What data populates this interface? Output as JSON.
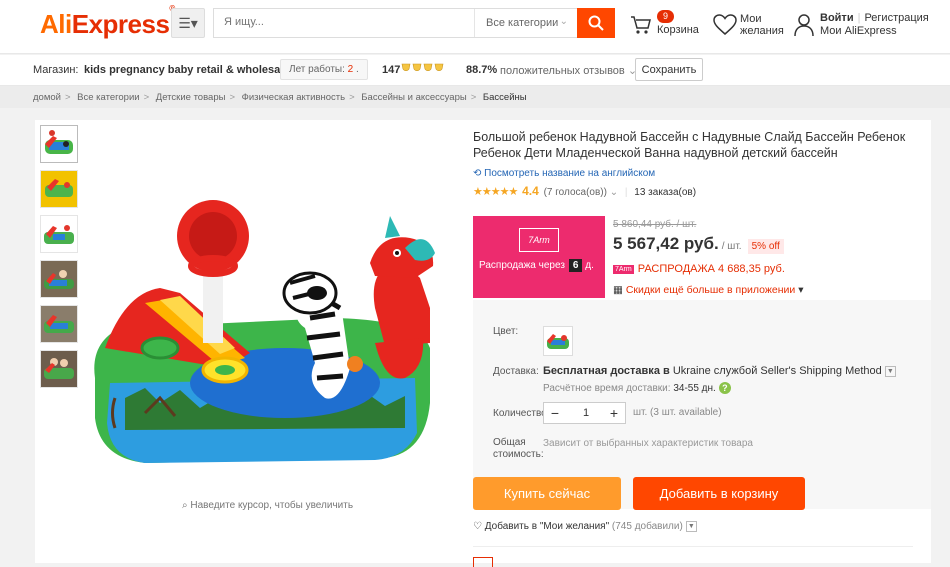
{
  "header": {
    "logo_a": "Ali",
    "logo_b": "Express",
    "search_placeholder": "Я ищу...",
    "category": "Все категории",
    "cart_count": "9",
    "cart_label": "Корзина",
    "wishlist_l1": "Мои",
    "wishlist_l2": "желания",
    "login": "Войти",
    "register": "Регистрация",
    "my_account": "Мои AliExpress"
  },
  "store": {
    "label": "Магазин:",
    "name": "kids pregnancy baby retail & wholesale",
    "years_label": "Лет работы:",
    "years_value": "2",
    "score": "147",
    "positive_pct": "88.7%",
    "positive_label": "положительных отзывов",
    "save": "Сохранить"
  },
  "breadcrumb": {
    "items": [
      "домой",
      "Все категории",
      "Детские товары",
      "Физическая активность",
      "Бассейны и аксессуары"
    ],
    "current": "Бассейны"
  },
  "gallery": {
    "zoom_hint": "Наведите курсор, чтобы увеличить"
  },
  "product": {
    "title": "Большой ребенок Надувной Бассейн с Надувные Слайд Бассейн Ребенок Ребенок Дети Младенческой Ванна надувной детский бассейн",
    "english_link": "Посмотреть название на английском",
    "rating": "4.4",
    "votes": "(7 голоса(ов))",
    "orders": "13 заказа(ов)",
    "sale_brand": "7Arm",
    "sale_text": "Распродажа через",
    "sale_days": "6",
    "sale_days_unit": "д.",
    "old_price": "5 860,44 руб. / шт.",
    "price": "5 567,42 руб.",
    "price_unit": "/ шт.",
    "discount": "5% off",
    "sale_price_tag": "7Arm",
    "sale_price": "РАСПРОДАЖА 4 688,35 руб.",
    "app_discount": "Скидки ещё больше в приложении"
  },
  "props": {
    "color_label": "Цвет:",
    "shipping_label": "Доставка:",
    "shipping_free": "Бесплатная доставка в",
    "shipping_rest": "Ukraine службой Seller's Shipping Method",
    "eta_label": "Расчётное время доставки:",
    "eta_value": "34-55 дн.",
    "qty_label": "Количество:",
    "qty_value": "1",
    "qty_avail": "шт. (3 шт. available)",
    "total_label_1": "Общая",
    "total_label_2": "стоимость:",
    "total_value": "Зависит от выбранных характеристик товара"
  },
  "actions": {
    "buy_now": "Купить сейчас",
    "add_to_cart": "Добавить в корзину",
    "wish": "Добавить в \"Мои желания\"",
    "wish_count": "(745 добавили)"
  },
  "accent": {
    "orange": "#ff6a00",
    "red": "#e62e04",
    "buy": "#ff9b2c",
    "cart": "#ff4700",
    "sale": "#ed2b6e"
  }
}
